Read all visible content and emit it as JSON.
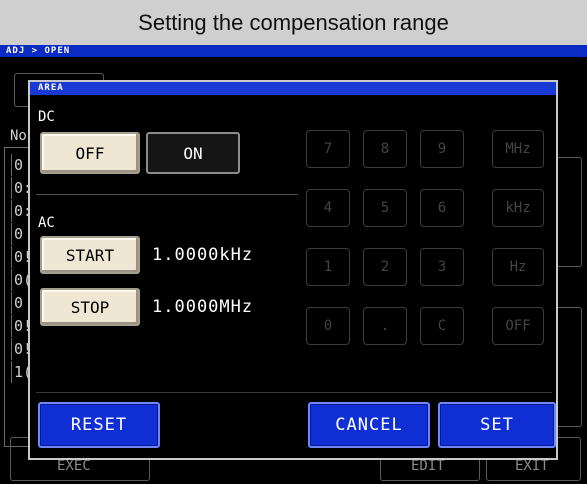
{
  "caption": "Setting the compensation range",
  "breadcrumb": "ADJ > OPEN",
  "background": {
    "row_labels": [
      "0",
      "0:",
      "0:",
      "0",
      "0!",
      "0(",
      "0",
      "0!",
      "0!",
      "1("
    ],
    "header_label": "No",
    "exec_label": "EXEC",
    "edit_label": "EDIT",
    "exit_label": "EXIT"
  },
  "dialog": {
    "title": "AREA",
    "dc": {
      "label": "DC",
      "off_label": "OFF",
      "on_label": "ON",
      "selected": "ON"
    },
    "ac": {
      "label": "AC",
      "start_label": "START",
      "start_value": "1.0000kHz",
      "stop_label": "STOP",
      "stop_value": "1.0000MHz"
    },
    "keypad": {
      "keys": [
        "7",
        "8",
        "9",
        "MHz",
        "4",
        "5",
        "6",
        "kHz",
        "1",
        "2",
        "3",
        "Hz",
        "0",
        ".",
        "C",
        "OFF"
      ],
      "enabled": false
    },
    "footer": {
      "reset_label": "RESET",
      "cancel_label": "CANCEL",
      "set_label": "SET"
    }
  },
  "colors": {
    "title_bar": "#1a38d6",
    "button_blue": "#0f2fd4",
    "button_beige": "#efe7d3",
    "background": "#000000"
  }
}
